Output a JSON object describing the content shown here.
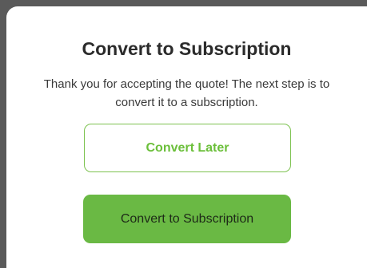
{
  "dialog": {
    "title": "Convert to Subscription",
    "message": "Thank you for accepting the quote! The next step is to convert it to a subscription.",
    "buttons": {
      "later_label": "Convert Later",
      "convert_label": "Convert to Subscription"
    }
  },
  "colors": {
    "accent": "#6ab944",
    "accent_text": "#6bbf3a",
    "title_text": "#2b2b2b",
    "backdrop": "#5a5a5a"
  }
}
